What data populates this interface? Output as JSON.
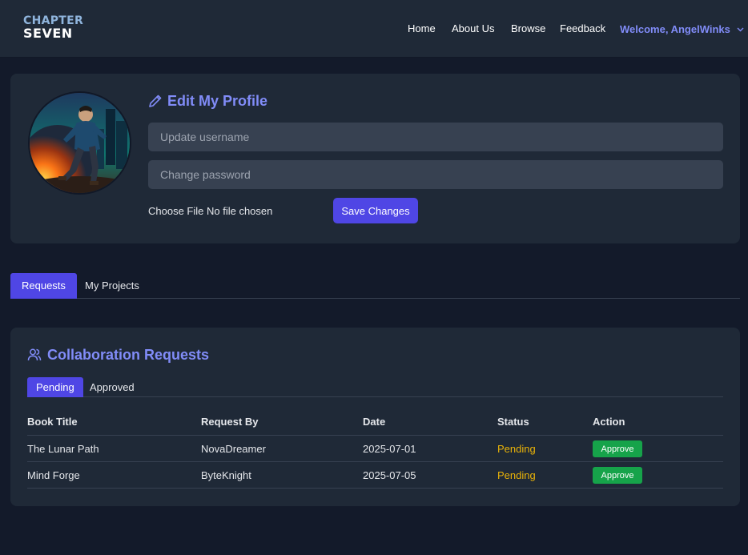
{
  "navbar": {
    "logo_top": "CHAPTER",
    "logo_bottom": "SEVEN",
    "links": [
      "Home",
      "About Us",
      "Browse",
      "Feedback"
    ],
    "welcome": "Welcome, AngelWinks"
  },
  "profile": {
    "title": "Edit My Profile",
    "username_placeholder": "Update username",
    "password_placeholder": "Change password",
    "file_label": "Choose File No file chosen",
    "save_label": "Save Changes"
  },
  "main_tabs": [
    "Requests",
    "My Projects"
  ],
  "collab": {
    "title": "Collaboration Requests",
    "sub_tabs": [
      "Pending",
      "Approved"
    ],
    "columns": [
      "Book Title",
      "Request By",
      "Date",
      "Status",
      "Action"
    ],
    "rows": [
      {
        "book": "The Lunar Path",
        "by": "NovaDreamer",
        "date": "2025-07-01",
        "status": "Pending",
        "action": "Approve"
      },
      {
        "book": "Mind Forge",
        "by": "ByteKnight",
        "date": "2025-07-05",
        "status": "Pending",
        "action": "Approve"
      }
    ]
  },
  "colors": {
    "accent": "#818cf8",
    "primary_button": "#4f46e5",
    "approve_button": "#16a34a",
    "pending_status": "#eab308"
  }
}
